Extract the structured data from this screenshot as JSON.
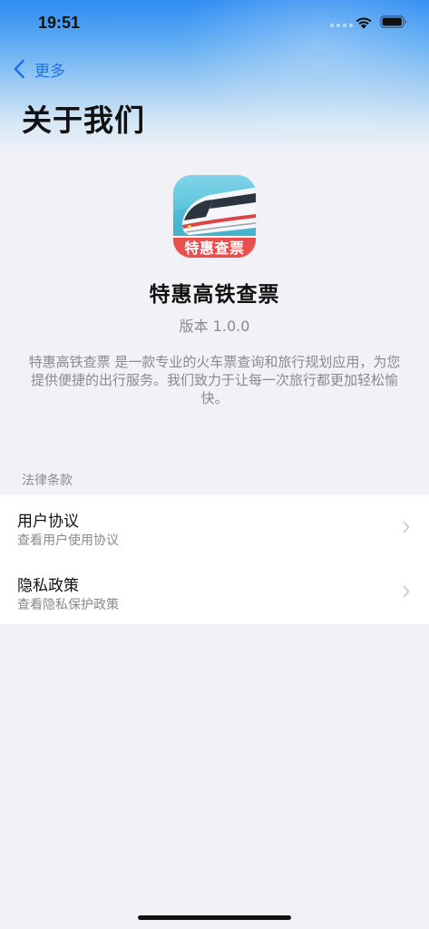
{
  "status_bar": {
    "time": "19:51"
  },
  "nav": {
    "back_label": "更多"
  },
  "page": {
    "title": "关于我们"
  },
  "app": {
    "icon_banner": "特惠查票",
    "name": "特惠高铁查票",
    "version": "版本 1.0.0",
    "description": "特惠高铁查票 是一款专业的火车票查询和旅行规划应用，为您提供便捷的出行服务。我们致力于让每一次旅行都更加轻松愉快。"
  },
  "legal_section": {
    "header": "法律条款",
    "items": [
      {
        "title": "用户协议",
        "subtitle": "查看用户使用协议"
      },
      {
        "title": "隐私政策",
        "subtitle": "查看隐私保护政策"
      }
    ]
  },
  "colors": {
    "accent": "#1a73e8",
    "icon_banner": "#e94f4f"
  }
}
